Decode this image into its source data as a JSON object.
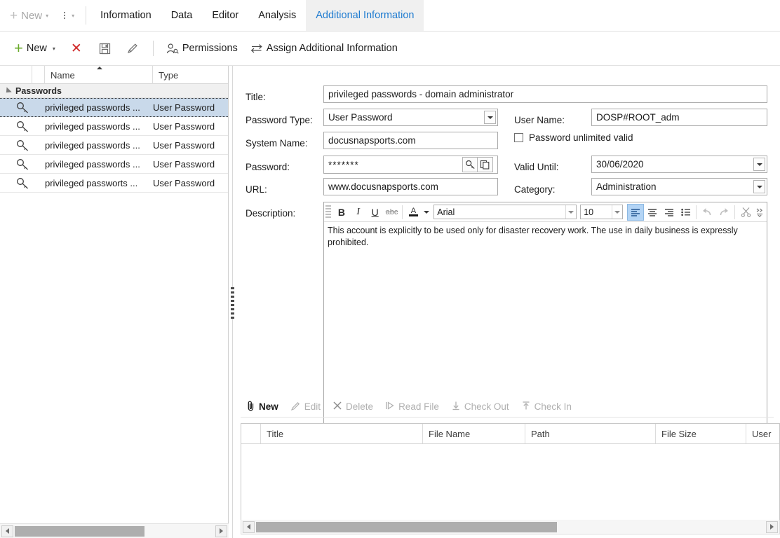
{
  "tabbar": {
    "new_label": "New",
    "caret": "▾",
    "tabs": [
      {
        "label": "Information",
        "active": false
      },
      {
        "label": "Data",
        "active": false
      },
      {
        "label": "Editor",
        "active": false
      },
      {
        "label": "Analysis",
        "active": false
      },
      {
        "label": "Additional Information",
        "active": true
      }
    ]
  },
  "toolbar": {
    "new_label": "New",
    "new_caret": "▾",
    "delete_label": "",
    "permissions_label": "Permissions",
    "assign_label": "Assign Additional Information"
  },
  "grid": {
    "columns": [
      "",
      "",
      "Name",
      "Type"
    ],
    "group_label": "Passwords",
    "rows": [
      {
        "name": "privileged passwords ...",
        "type": "User Password",
        "selected": true
      },
      {
        "name": "privileged passwords ...",
        "type": "User Password",
        "selected": false
      },
      {
        "name": "privileged passwords ...",
        "type": "User Password",
        "selected": false
      },
      {
        "name": "privileged passwords ...",
        "type": "User Password",
        "selected": false
      },
      {
        "name": "privileged passworts ...",
        "type": "User Password",
        "selected": false
      }
    ]
  },
  "form": {
    "title_label": "Title:",
    "title_value": "privileged passwords - domain administrator",
    "password_type_label": "Password Type:",
    "password_type_value": "User Password",
    "system_name_label": "System Name:",
    "system_name_value": "docusnapsports.com",
    "password_label": "Password:",
    "password_value": "*******",
    "url_label": "URL:",
    "url_value": "www.docusnapsports.com",
    "description_label": "Description:",
    "user_name_label": "User Name:",
    "user_name_value": "DOSP#ROOT_adm",
    "unlimited_label": "Password unlimited valid",
    "unlimited_checked": false,
    "valid_until_label": "Valid Until:",
    "valid_until_value": "30/06/2020",
    "category_label": "Category:",
    "category_value": "Administration"
  },
  "rte": {
    "bold": "B",
    "italic": "I",
    "underline": "U",
    "strike": "abc",
    "fontcolor": "A",
    "font_name": "Arial",
    "font_size": "10",
    "body_text": "This account is explicitly to be used only for disaster recovery work.  The use in daily business is expressly prohibited."
  },
  "attachments": {
    "toolbar": [
      {
        "label": "New",
        "enabled": true
      },
      {
        "label": "Edit",
        "enabled": false
      },
      {
        "label": "Delete",
        "enabled": false
      },
      {
        "label": "Read File",
        "enabled": false
      },
      {
        "label": "Check Out",
        "enabled": false
      },
      {
        "label": "Check In",
        "enabled": false
      }
    ],
    "columns": [
      "Title",
      "File Name",
      "Path",
      "File Size",
      "User"
    ],
    "rows": []
  },
  "colors": {
    "accent_blue": "#1e7bd0",
    "green": "#6aab2b",
    "red": "#d02a2a",
    "selection": "#c9d9ea",
    "tab_active_bg": "#f0f0f0"
  }
}
